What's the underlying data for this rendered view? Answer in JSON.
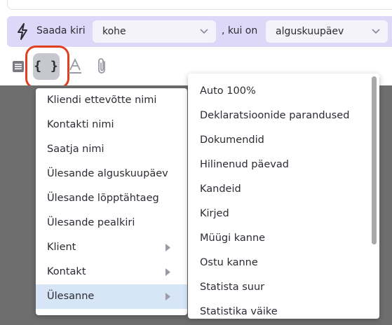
{
  "action_bar": {
    "icon": "lightning-bolt-icon",
    "send_label": "Saada kiri",
    "when_select": {
      "value": "kohe"
    },
    "if_label": ", kui on",
    "field_select": {
      "value": "alguskuupäev"
    }
  },
  "toolbar": {
    "list_icon": "list-icon",
    "variables_button": "{ }",
    "font_icon": "font-color-icon",
    "attach_icon": "paperclip-icon",
    "highlight_color": "#e0401f"
  },
  "menu": {
    "items": [
      {
        "label": "Kliendi ettevõtte nimi",
        "has_submenu": false
      },
      {
        "label": "Kontakti nimi",
        "has_submenu": false
      },
      {
        "label": "Saatja nimi",
        "has_submenu": false
      },
      {
        "label": "Ülesande alguskuupäev",
        "has_submenu": false
      },
      {
        "label": "Ülesande lõpptähtaeg",
        "has_submenu": false
      },
      {
        "label": "Ülesande pealkiri",
        "has_submenu": false
      },
      {
        "label": "Klient",
        "has_submenu": true
      },
      {
        "label": "Kontakt",
        "has_submenu": true
      },
      {
        "label": "Ülesanne",
        "has_submenu": true,
        "active": true
      }
    ]
  },
  "submenu": {
    "items": [
      "Auto 100%",
      "Deklaratsioonide parandused",
      "Dokumendid",
      "Hilinenud päevad",
      "Kandeid",
      "Kirjed",
      "Müügi kanne",
      "Ostu kanne",
      "Statista suur",
      "Statistika väike"
    ]
  }
}
